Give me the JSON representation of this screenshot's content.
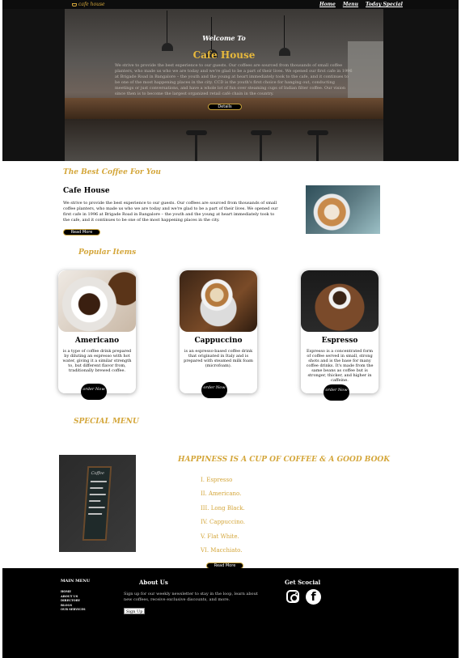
{
  "nav": {
    "brand": "cafe house",
    "links": [
      "Home",
      "Menu",
      "Today Special"
    ]
  },
  "hero": {
    "welcome": "Welcome To",
    "title": "Cafe House",
    "description": "We strive to provide the best experience to our guests. Our coffees are sourced from thousands of small coffee planters, who made us who we are today and we're glad to be a part of their lives. We opened our first cafe in 1996 at Brigade Road in Bangalore – the youth and the young at heart immediately took to the cafe, and it continues to be one of the most happening places in the city. CCD is the youth's first choice for hanging out, conducting meetings or just conversations, and have a whole lot of fun over steaming cups of Indian filter coffee. Our vision since then is to become the largest organized retail café chain in the country.",
    "button": "Details"
  },
  "about": {
    "section_title": "The Best Coffee For You",
    "heading": "Cafe House",
    "text": "We strive to provide the best experience to our guests. Our coffees are sourced from thousands of small coffee planters, who made us who we are today and we're glad to be a part of their lives. We opened our first cafe in 1996 at Brigade Road in Bangalore – the youth and the young at heart immediately took to the cafe, and it continues to be one of the most happening places in the city.",
    "button": "Read More"
  },
  "popular": {
    "section_title": "Popular Items",
    "items": [
      {
        "name": "Americano",
        "text": "is a type of coffee drink prepared by diluting an espresso with hot water, giving it a similar strength to, but different flavor from, traditionally brewed coffee.",
        "button": "order Now"
      },
      {
        "name": "Cappuccino",
        "text": "is an espresso-based coffee drink that originated in Italy and is prepared with steamed milk foam (microfoam).",
        "button": "order Now"
      },
      {
        "name": "Espresso",
        "text": "Espresso is a concentrated form of coffee served in small, strong shots and is the base for many coffee drinks. It's made from the same beans as coffee but is stronger, thicker, and higher in caffeine.",
        "button": "order Now"
      }
    ]
  },
  "special": {
    "section_title": "SPECIAL MENU",
    "heading": "HAPPINESS IS A CUP OF COFFEE & A GOOD BOOK",
    "board_text": "Coffee",
    "items": [
      "I. Espresso",
      "II. Americano.",
      "III. Long Black.",
      "IV. Cappuccino.",
      "V. Flat White.",
      "VI. Macchiato."
    ],
    "button": "Read More"
  },
  "footer": {
    "main_menu_title": "MAIN MENU",
    "main_menu": [
      "HOME",
      "ABOUT US",
      "DIRECTORY",
      "BLOGS",
      "OUR SERVICES"
    ],
    "about_title": "About Us",
    "newsletter": "Sign up for our weekly newsletter to stay in the loop, learn about new coffees, receive exclusive discounts, and more.",
    "signup": "Sign Up",
    "social_title": "Get Scocial"
  },
  "colors": {
    "gold": "#d4a63a",
    "dark": "#0d0d0d"
  }
}
